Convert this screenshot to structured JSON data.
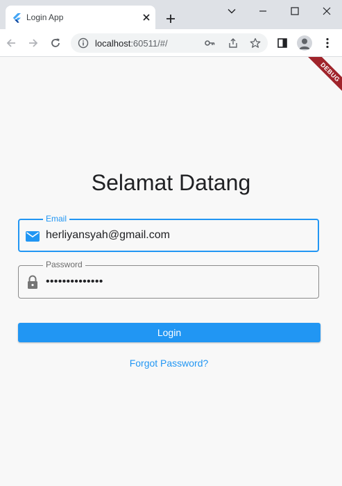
{
  "browser": {
    "tab_title": "Login App",
    "url_host": "localhost",
    "url_rest": ":60511/#/"
  },
  "app": {
    "debug_banner": "DEBUG",
    "heading": "Selamat Datang",
    "email": {
      "label": "Email",
      "value": "herliyansyah@gmail.com"
    },
    "password": {
      "label": "Password",
      "value": "••••••••••••••"
    },
    "login_label": "Login",
    "forgot_label": "Forgot Password?"
  },
  "colors": {
    "accent": "#2196f3",
    "background": "#f8f8f8",
    "debug_banner": "#a0242b"
  }
}
